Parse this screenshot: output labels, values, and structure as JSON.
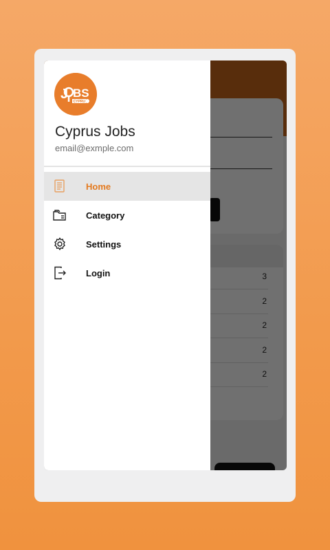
{
  "drawer": {
    "app_name": "Cyprus Jobs",
    "email": "email@exmple.com",
    "logo": {
      "text_main": "JOBS",
      "text_sub": "CYPRUS",
      "color": "#e87d2b"
    },
    "menu": [
      {
        "label": "Home",
        "icon": "document-list-icon",
        "active": true
      },
      {
        "label": "Category",
        "icon": "folders-icon",
        "active": false
      },
      {
        "label": "Settings",
        "icon": "gear-icon",
        "active": false
      },
      {
        "label": "Login",
        "icon": "login-icon",
        "active": false
      }
    ]
  },
  "background": {
    "counts": [
      "3",
      "2",
      "2",
      "2",
      "2"
    ]
  },
  "colors": {
    "accent": "#e47a1f",
    "active_bg": "#e5e5e5"
  }
}
